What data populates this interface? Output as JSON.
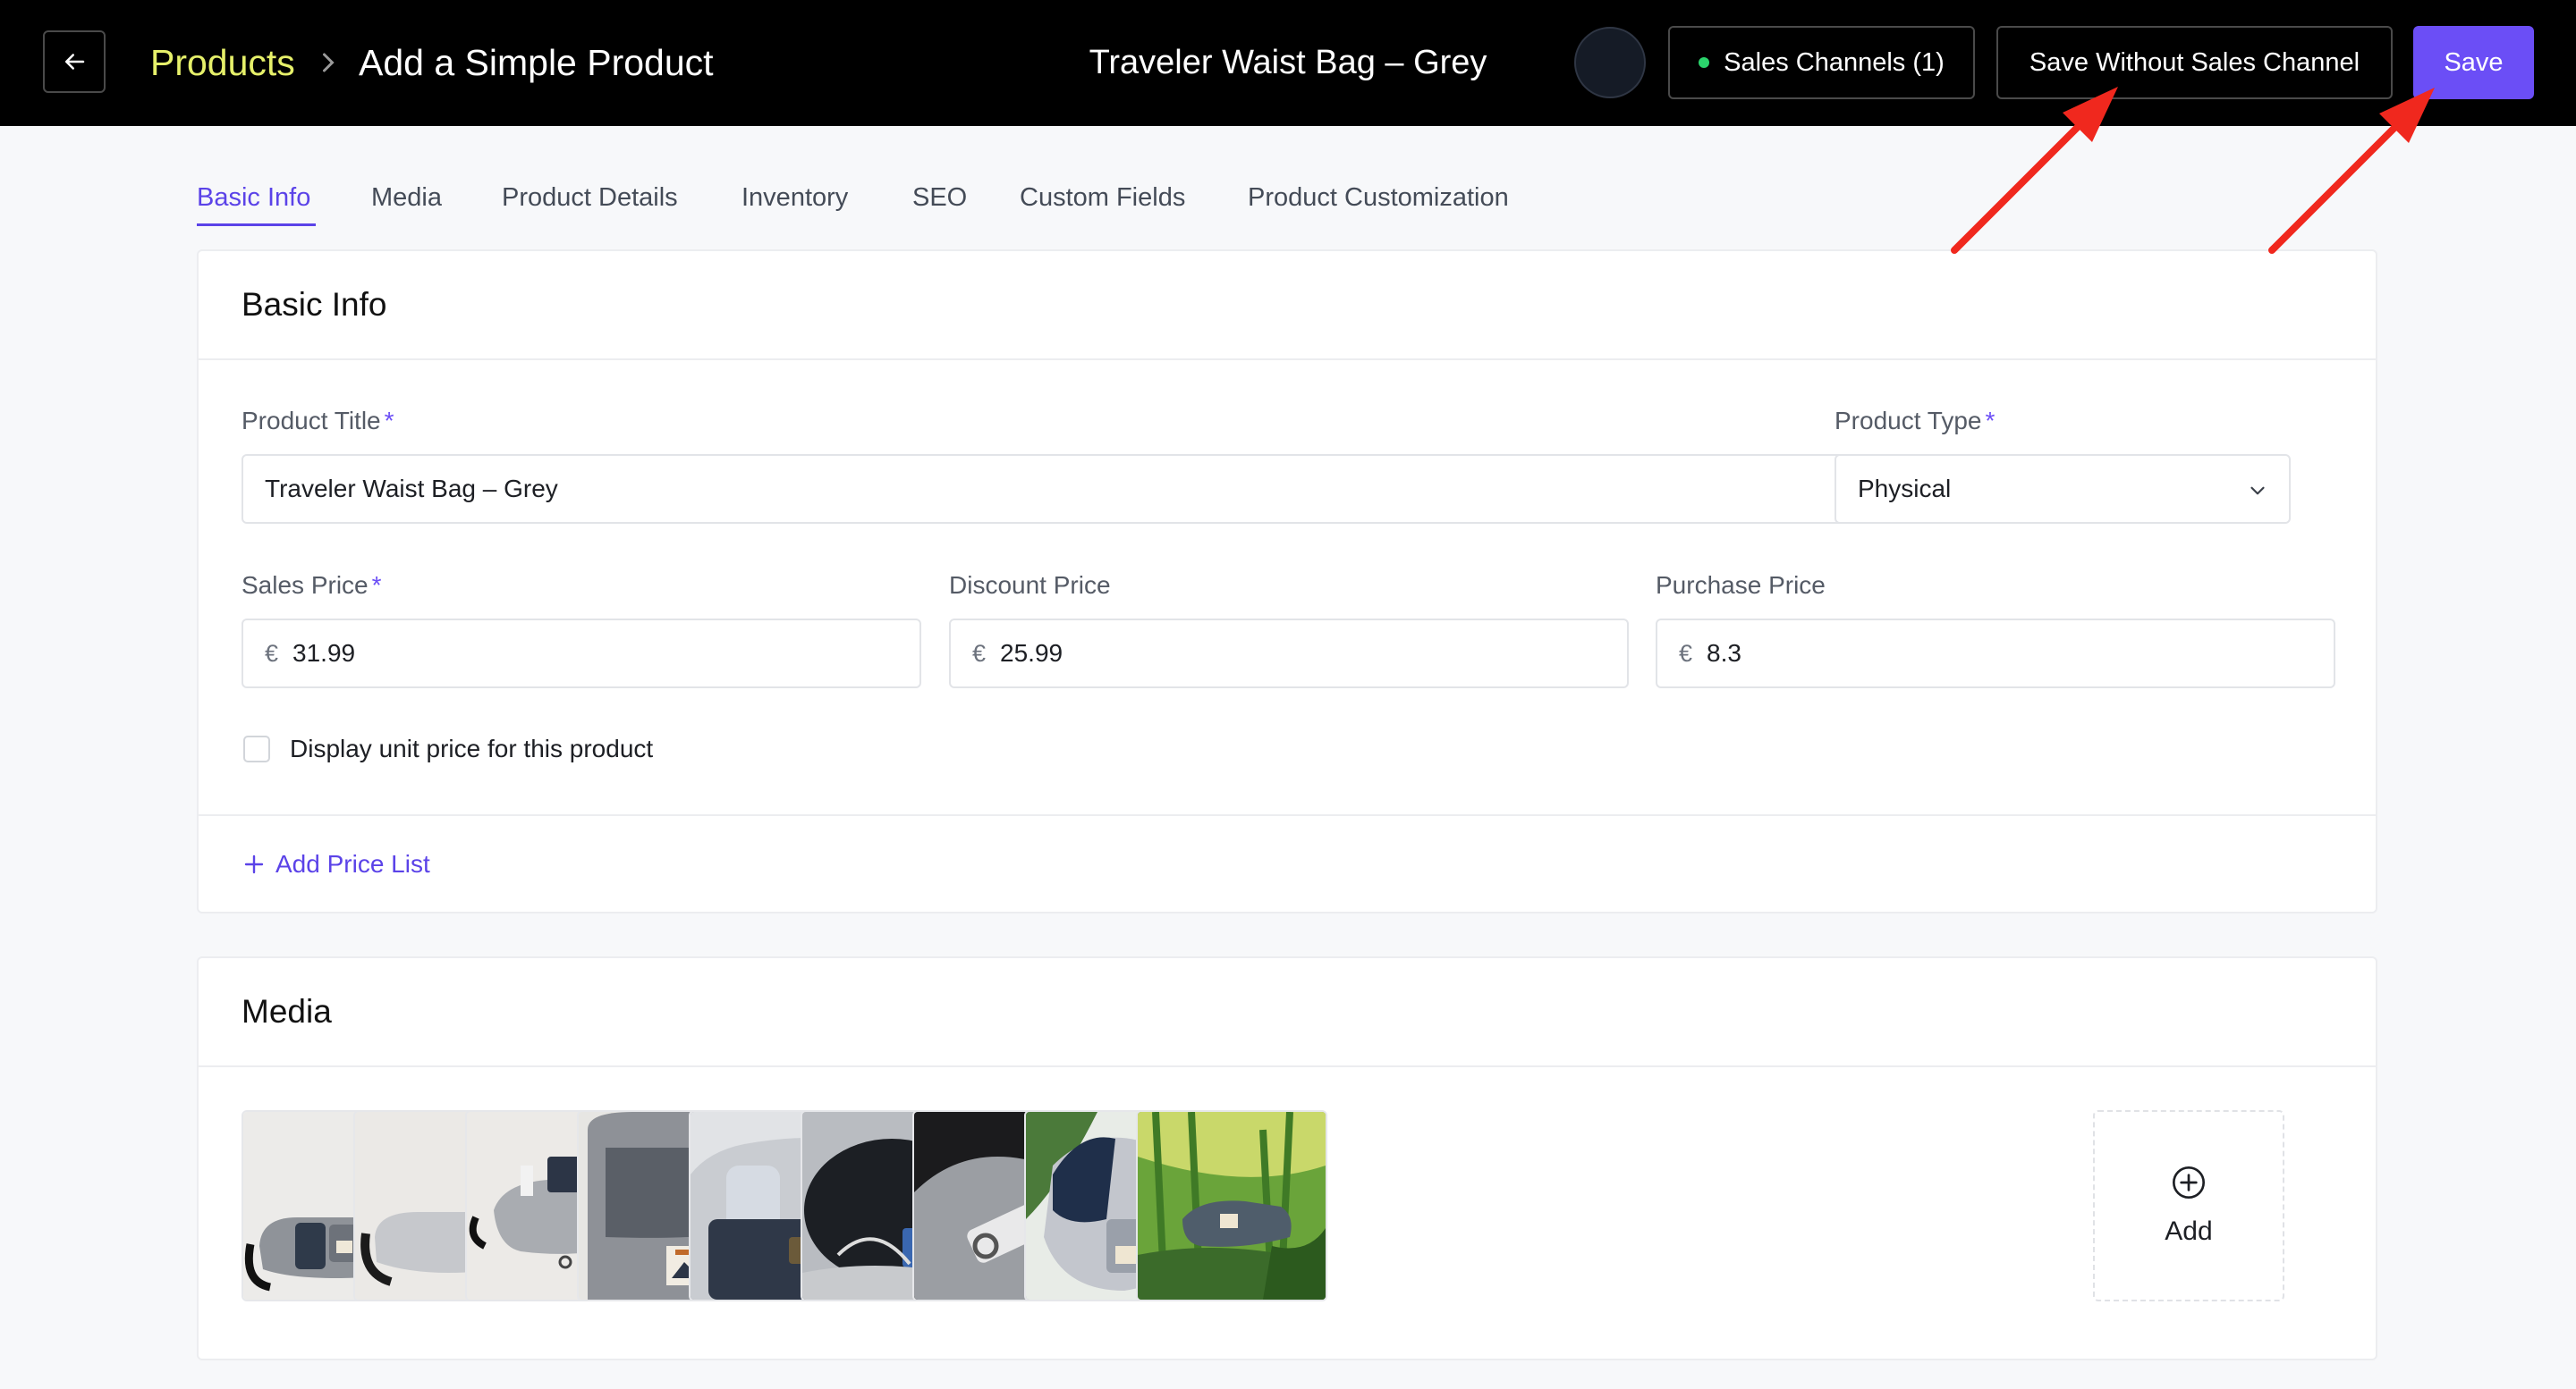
{
  "header": {
    "breadcrumb_root": "Products",
    "breadcrumb_page": "Add a Simple Product",
    "product_title": "Traveler Waist Bag – Grey",
    "sales_channels_label": "Sales Channels (1)",
    "save_without_label": "Save Without Sales Channel",
    "save_label": "Save"
  },
  "tabs": [
    {
      "label": "Basic Info",
      "active": true
    },
    {
      "label": "Media"
    },
    {
      "label": "Product Details"
    },
    {
      "label": "Inventory"
    },
    {
      "label": "SEO"
    },
    {
      "label": "Custom Fields"
    },
    {
      "label": "Product Customization"
    }
  ],
  "basic_info": {
    "section_title": "Basic Info",
    "product_title": {
      "label": "Product Title",
      "value": "Traveler Waist Bag – Grey"
    },
    "product_type": {
      "label": "Product Type",
      "value": "Physical"
    },
    "sales_price": {
      "label": "Sales Price",
      "currency": "€",
      "value": "31.99"
    },
    "discount_price": {
      "label": "Discount Price",
      "currency": "€",
      "value": "25.99"
    },
    "purchase_price": {
      "label": "Purchase Price",
      "currency": "€",
      "value": "8.3"
    },
    "unit_price_checkbox": {
      "label": "Display unit price for this product",
      "checked": false
    },
    "add_price_list_label": "Add Price List",
    "required_marker": "*"
  },
  "media": {
    "section_title": "Media",
    "add_label": "Add",
    "image_count": 9
  },
  "colors": {
    "accent": "#6b4ef6",
    "breadcrumb": "#e6f06a",
    "annotation_arrow": "#f0281e",
    "status_dot": "#2bd46c"
  }
}
